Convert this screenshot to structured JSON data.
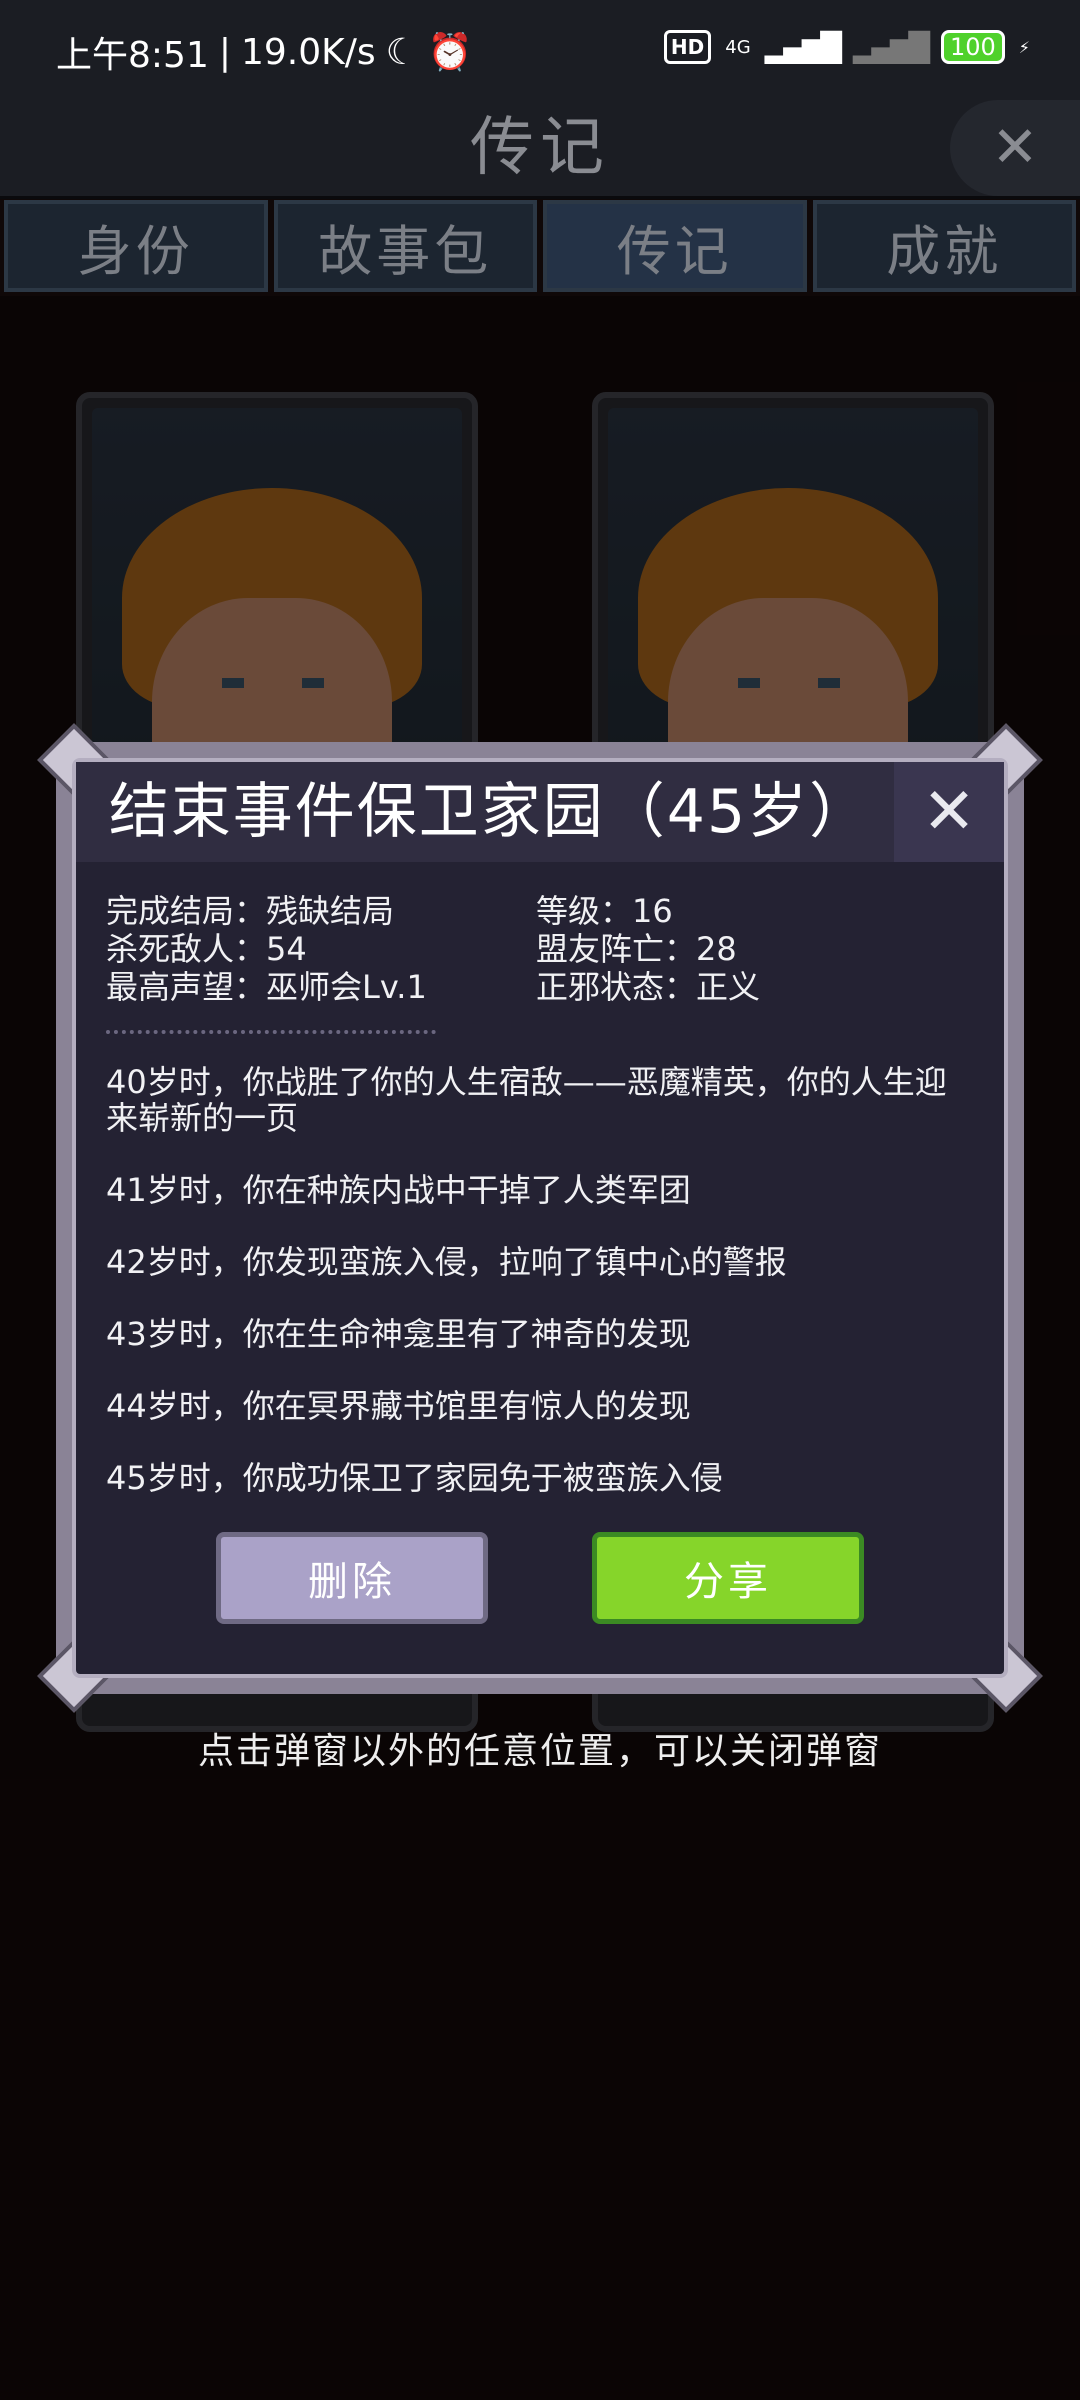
{
  "status_bar": {
    "time": "上午8:51",
    "speed": "19.0K/s",
    "hd": "HD",
    "network": "4G",
    "battery": "100"
  },
  "header": {
    "title": "传记"
  },
  "tabs": [
    {
      "label": "身份"
    },
    {
      "label": "故事包"
    },
    {
      "label": "传记"
    },
    {
      "label": "成就"
    }
  ],
  "modal": {
    "title": "结束事件保卫家园（45岁）",
    "stats": {
      "ending_label": "完成结局：残缺结局",
      "level_label": "等级：16",
      "kills_label": "杀死敌人：54",
      "allies_label": "盟友阵亡：28",
      "fame_label": "最高声望：巫师会Lv.1",
      "alignment_label": "正邪状态：正义"
    },
    "events": [
      "40岁时，你战胜了你的人生宿敌——恶魔精英，你的人生迎来崭新的一页",
      "41岁时，你在种族内战中干掉了人类军团",
      "42岁时，你发现蛮族入侵，拉响了镇中心的警报",
      "43岁时，你在生命神龛里有了神奇的发现",
      "44岁时，你在冥界藏书馆里有惊人的发现",
      "45岁时，你成功保卫了家园免于被蛮族入侵"
    ],
    "delete_label": "删除",
    "share_label": "分享"
  },
  "hint": "点击弹窗以外的任意位置，可以关闭弹窗",
  "colors": {
    "background": "#0f0808",
    "share_button": "#86d52a",
    "delete_button": "#aaa2c8",
    "modal_bg": "#242233"
  }
}
